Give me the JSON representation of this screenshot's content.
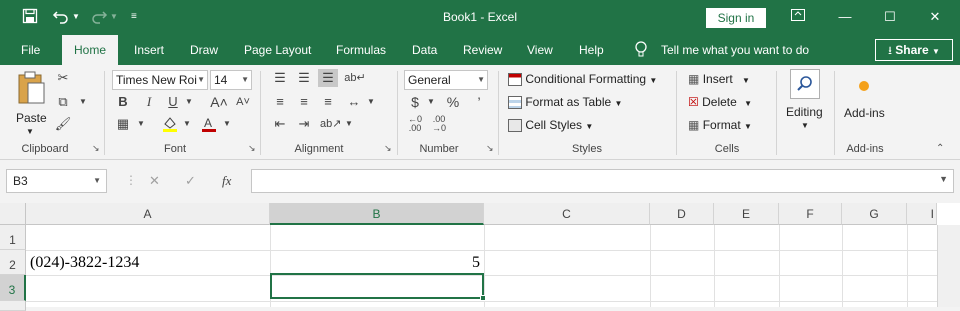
{
  "titlebar": {
    "title": "Book1  -  Excel",
    "sign_in": "Sign in",
    "icons": [
      "save-icon",
      "undo-icon",
      "redo-icon",
      "customize-qat-icon"
    ]
  },
  "menu": {
    "tabs": [
      "File",
      "Home",
      "Insert",
      "Draw",
      "Page Layout",
      "Formulas",
      "Data",
      "Review",
      "View",
      "Help"
    ],
    "active": "Home",
    "tell_me": "Tell me what you want to do",
    "share": "Share"
  },
  "ribbon": {
    "clipboard": {
      "label": "Clipboard",
      "paste": "Paste"
    },
    "font": {
      "label": "Font",
      "name": "Times New Roi",
      "size": "14",
      "bold": "B",
      "italic": "I",
      "underline": "U"
    },
    "alignment": {
      "label": "Alignment"
    },
    "number": {
      "label": "Number",
      "format": "General",
      "currency": "$",
      "percent": "%",
      "comma": "’"
    },
    "styles": {
      "label": "Styles",
      "conditional": "Conditional Formatting",
      "format_table": "Format as Table",
      "cell_styles": "Cell Styles"
    },
    "cells": {
      "label": "Cells",
      "insert": "Insert",
      "delete": "Delete",
      "format": "Format"
    },
    "editing": {
      "label": "Editing"
    },
    "addins": {
      "label": "Add-ins",
      "button": "Add-ins"
    }
  },
  "formula_bar": {
    "name_box": "B3",
    "fx": "fx",
    "content": ""
  },
  "sheet": {
    "columns": [
      "A",
      "B",
      "C",
      "D",
      "E",
      "F",
      "G"
    ],
    "rows": [
      "1",
      "2",
      "3"
    ],
    "cells": {
      "A2": "(024)-3822-1234",
      "B2": "5"
    },
    "selected": "B3"
  },
  "colors": {
    "accent": "#217346"
  }
}
